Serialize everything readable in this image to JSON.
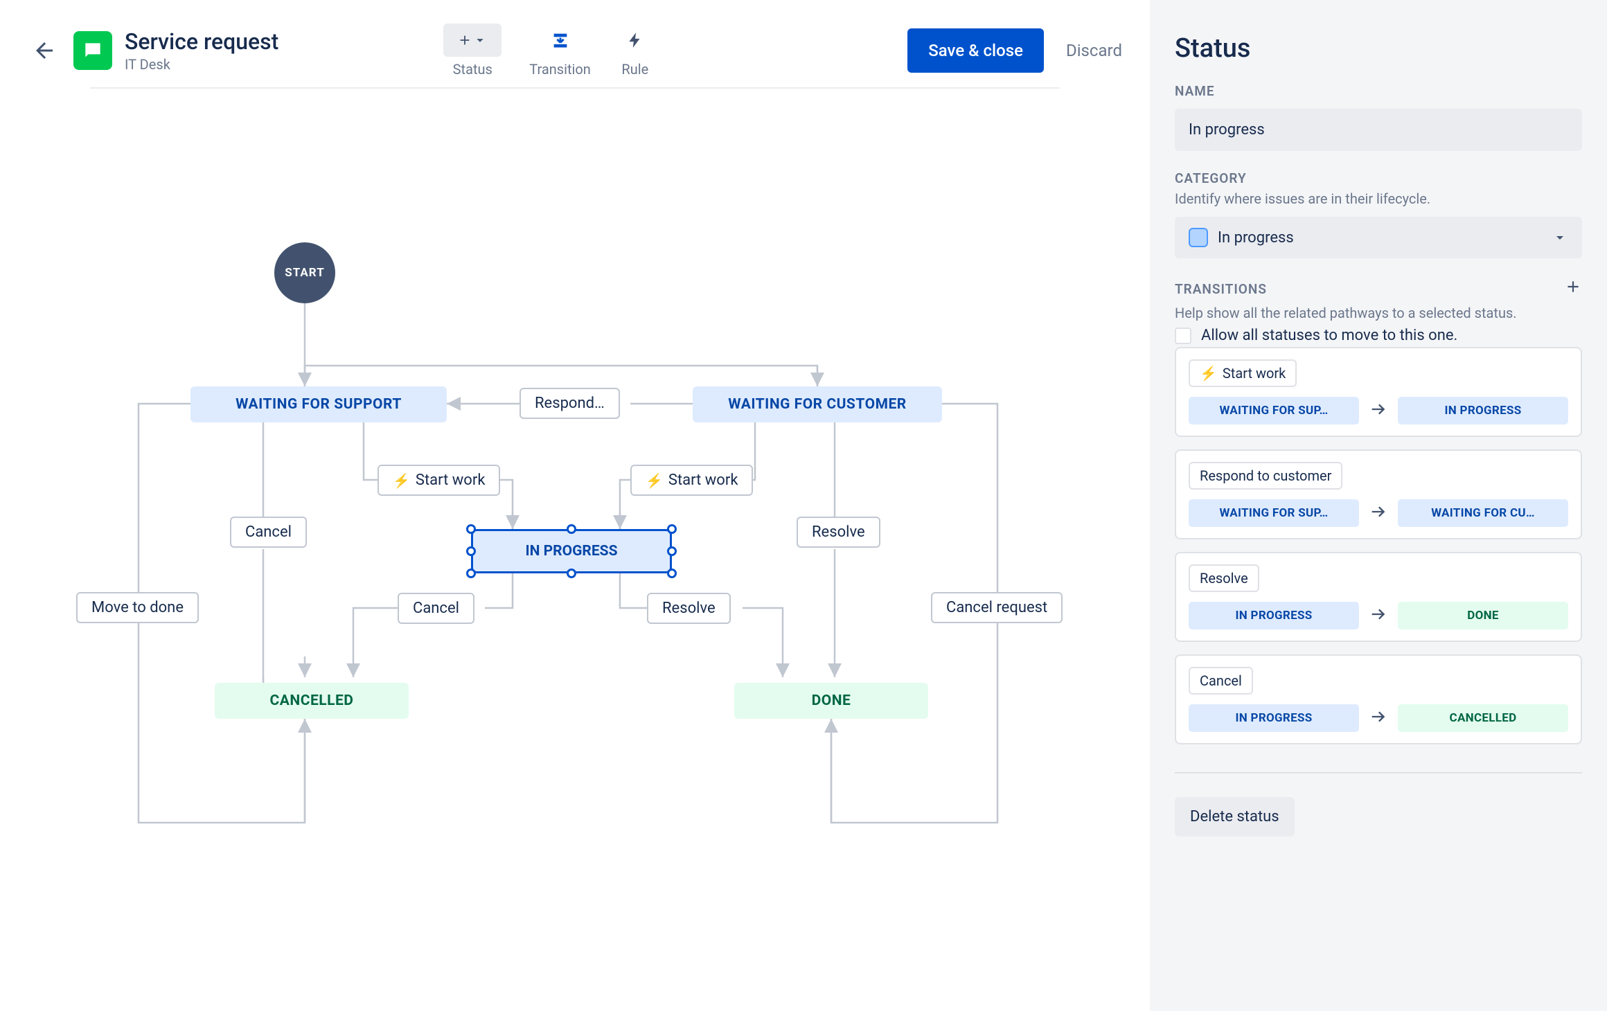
{
  "header": {
    "title": "Service request",
    "subtitle": "IT Desk",
    "toolbar": {
      "status": "Status",
      "transition": "Transition",
      "rule": "Rule"
    },
    "save": "Save & close",
    "discard": "Discard"
  },
  "workflow": {
    "start": "START",
    "statuses": {
      "waiting_support": "WAITING FOR SUPPORT",
      "waiting_customer": "WAITING FOR CUSTOMER",
      "in_progress": "IN PROGRESS",
      "cancelled": "CANCELLED",
      "done": "DONE"
    },
    "transitions": {
      "respond": "Respond…",
      "start_work_1": "Start work",
      "start_work_2": "Start work",
      "cancel_1": "Cancel",
      "cancel_2": "Cancel",
      "resolve_1": "Resolve",
      "resolve_2": "Resolve",
      "move_to_done": "Move to done",
      "cancel_request": "Cancel request"
    }
  },
  "sidebar": {
    "title": "Status",
    "name_label": "NAME",
    "name_value": "In progress",
    "category_label": "CATEGORY",
    "category_desc": "Identify where issues are in their lifecycle.",
    "category_value": "In progress",
    "transitions_label": "TRANSITIONS",
    "transitions_desc": "Help show all the related pathways to a selected status.",
    "allow_all": "Allow all statuses to move to this one.",
    "cards": [
      {
        "title": "Start work",
        "bolt": true,
        "from": "WAITING FOR SUP…",
        "to": "IN PROGRESS",
        "from_cat": "blue",
        "to_cat": "blue"
      },
      {
        "title": "Respond to customer",
        "bolt": false,
        "from": "WAITING FOR SUP…",
        "to": "WAITING FOR CU…",
        "from_cat": "blue",
        "to_cat": "blue"
      },
      {
        "title": "Resolve",
        "bolt": false,
        "from": "IN PROGRESS",
        "to": "DONE",
        "from_cat": "blue",
        "to_cat": "grn"
      },
      {
        "title": "Cancel",
        "bolt": false,
        "from": "IN PROGRESS",
        "to": "CANCELLED",
        "from_cat": "blue",
        "to_cat": "grn"
      }
    ],
    "delete": "Delete status"
  }
}
